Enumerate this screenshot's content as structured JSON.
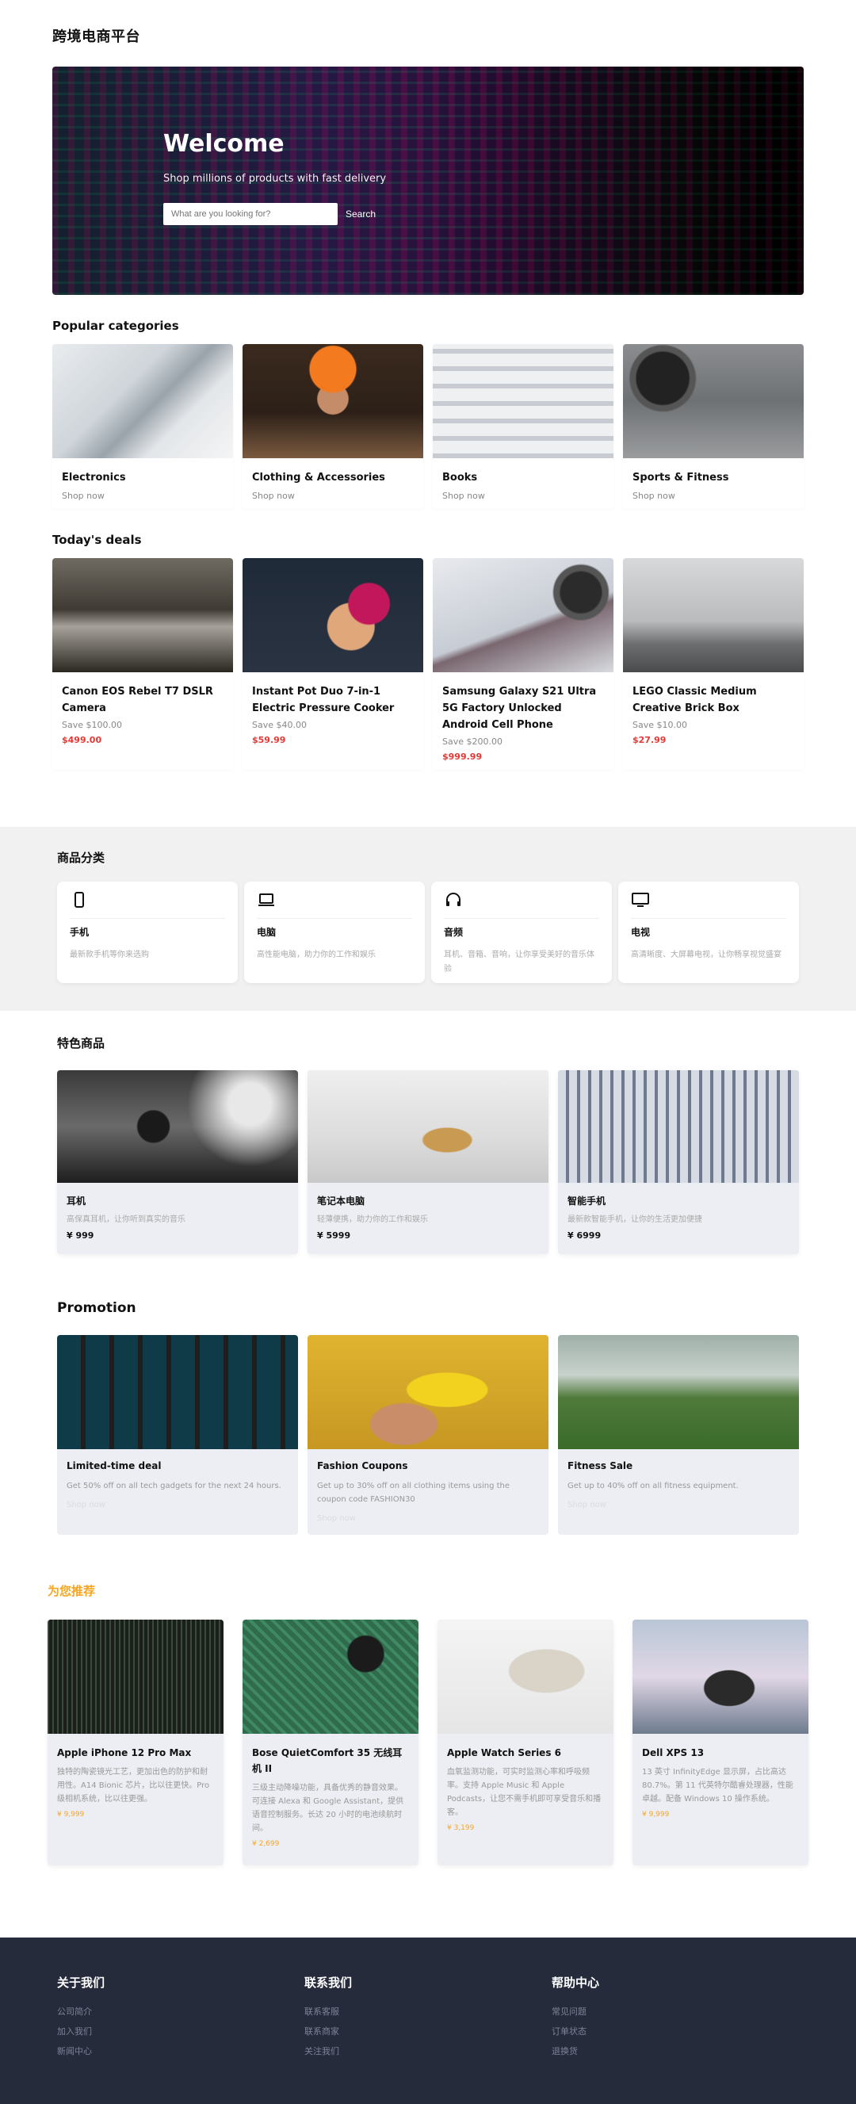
{
  "header": {
    "title": "跨境电商平台"
  },
  "hero": {
    "title": "Welcome",
    "subtitle": "Shop millions of products with fast delivery",
    "search_placeholder": "What are you looking for?",
    "search_button": "Search"
  },
  "popular": {
    "title": "Popular categories",
    "items": [
      {
        "name": "Electronics",
        "link": "Shop now"
      },
      {
        "name": "Clothing & Accessories",
        "link": "Shop now"
      },
      {
        "name": "Books",
        "link": "Shop now"
      },
      {
        "name": "Sports & Fitness",
        "link": "Shop now"
      }
    ]
  },
  "deals": {
    "title": "Today's deals",
    "items": [
      {
        "name": "Canon EOS Rebel T7 DSLR Camera",
        "save": "Save $100.00",
        "price": "$499.00"
      },
      {
        "name": "Instant Pot Duo 7-in-1 Electric Pressure Cooker",
        "save": "Save $40.00",
        "price": "$59.99"
      },
      {
        "name": "Samsung Galaxy S21 Ultra 5G Factory Unlocked Android Cell Phone",
        "save": "Save $200.00",
        "price": "$999.99"
      },
      {
        "name": "LEGO Classic Medium Creative Brick Box",
        "save": "Save $10.00",
        "price": "$27.99"
      }
    ]
  },
  "categories": {
    "title": "商品分类",
    "items": [
      {
        "icon": "phone-icon",
        "name": "手机",
        "desc": "最新款手机等你来选购"
      },
      {
        "icon": "laptop-icon",
        "name": "电脑",
        "desc": "高性能电脑，助力你的工作和娱乐"
      },
      {
        "icon": "headphones-icon",
        "name": "音频",
        "desc": "耳机、音箱、音响，让你享受美好的音乐体验"
      },
      {
        "icon": "tv-icon",
        "name": "电视",
        "desc": "高清晰度、大屏幕电视，让你畅享视觉盛宴"
      }
    ]
  },
  "featured": {
    "title": "特色商品",
    "items": [
      {
        "name": "耳机",
        "desc": "高保真耳机，让你听到真实的音乐",
        "price": "¥ 999"
      },
      {
        "name": "笔记本电脑",
        "desc": "轻薄便携，助力你的工作和娱乐",
        "price": "¥ 5999"
      },
      {
        "name": "智能手机",
        "desc": "最新款智能手机，让你的生活更加便捷",
        "price": "¥ 6999"
      }
    ]
  },
  "promotion": {
    "title": "Promotion",
    "items": [
      {
        "name": "Limited-time deal",
        "desc": "Get 50% off on all tech gadgets for the next 24 hours.",
        "link": "Shop now"
      },
      {
        "name": "Fashion Coupons",
        "desc": "Get up to 30% off on all clothing items using the coupon code FASHION30",
        "link": "Shop now"
      },
      {
        "name": "Fitness Sale",
        "desc": "Get up to 40% off on all fitness equipment.",
        "link": "Shop now"
      }
    ]
  },
  "recommended": {
    "title": "为您推荐",
    "items": [
      {
        "name": "Apple iPhone 12 Pro Max",
        "desc": "独特的陶瓷镜光工艺，更加出色的防护和耐用性。A14 Bionic 芯片，比以往更快。Pro 级相机系统，比以往更强。",
        "price": "¥ 9,999"
      },
      {
        "name": "Bose QuietComfort 35 无线耳机 II",
        "desc": "三级主动降噪功能，具备优秀的静音效果。可连接 Alexa 和 Google Assistant，提供语音控制服务。长达 20 小时的电池续航时间。",
        "price": "¥ 2,699"
      },
      {
        "name": "Apple Watch Series 6",
        "desc": "血氧监测功能，可实时监测心率和呼吸频率。支持 Apple Music 和 Apple Podcasts，让您不需手机即可享受音乐和播客。",
        "price": "¥ 3,199"
      },
      {
        "name": "Dell XPS 13",
        "desc": "13 英寸 InfinityEdge 显示屏，占比高达 80.7%。第 11 代英特尔酷睿处理器，性能卓越。配备 Windows 10 操作系统。",
        "price": "¥ 9,999"
      }
    ]
  },
  "footer": {
    "columns": [
      {
        "title": "关于我们",
        "links": [
          "公司简介",
          "加入我们",
          "新闻中心"
        ]
      },
      {
        "title": "联系我们",
        "links": [
          "联系客服",
          "联系商家",
          "关注我们"
        ]
      },
      {
        "title": "帮助中心",
        "links": [
          "常见问题",
          "订单状态",
          "退换货"
        ]
      }
    ]
  }
}
